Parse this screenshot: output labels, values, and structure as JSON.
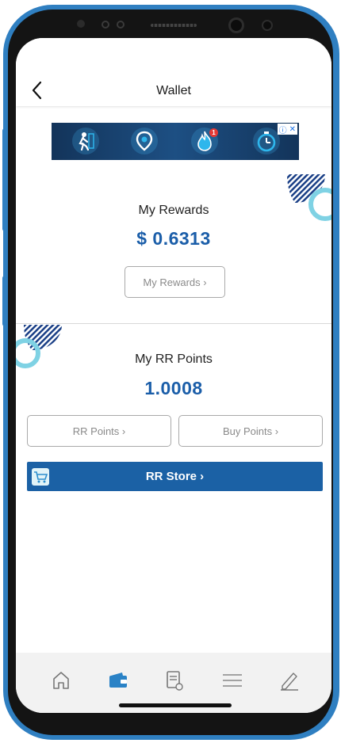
{
  "header": {
    "title": "Wallet"
  },
  "rewards": {
    "label": "My Rewards",
    "value": "$ 0.6313",
    "button_label": "My Rewards ›"
  },
  "points": {
    "label": "My RR Points",
    "value": "1.0008",
    "rr_points_button": "RR Points ›",
    "buy_points_button": "Buy Points ›"
  },
  "store": {
    "label": "RR Store ›"
  },
  "ad": {
    "badge": "1",
    "close_glyph": "✕",
    "info_glyph": "ⓘ"
  },
  "bottom_nav": {
    "items": [
      "home-icon",
      "wallet-icon",
      "receipt-icon",
      "menu-icon",
      "edit-icon"
    ],
    "active_color": "#2a82c6"
  },
  "colors": {
    "frame": "#2f7fc1",
    "accent": "#1b5ea9",
    "store_bar": "#1b61a5"
  }
}
